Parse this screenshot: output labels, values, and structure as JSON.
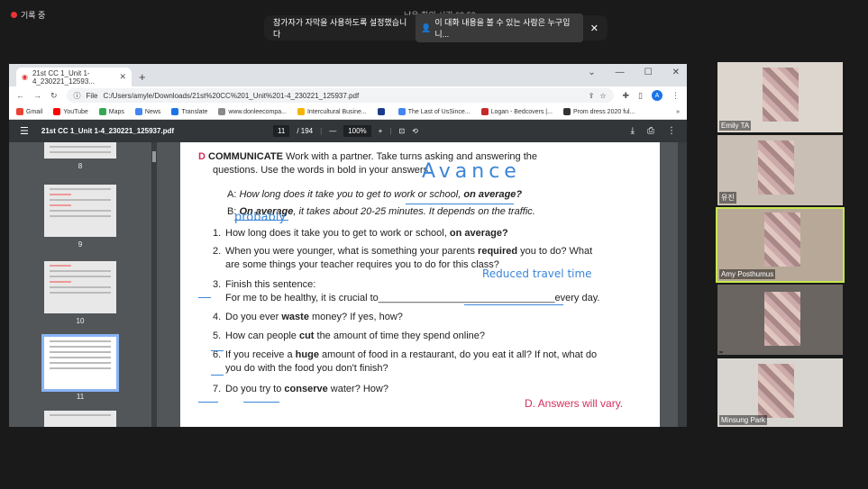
{
  "zoom": {
    "recording_label": "기록 중",
    "timer": "남은 회의 시간 09:53",
    "banner_text": "참가자가 자막을 사용하도록 설정했습니다",
    "banner_link": "이 대화 내용을 볼 수 있는 사람은 누구입니...",
    "close_glyph": "✕"
  },
  "browser": {
    "tab_title": "21st CC 1_Unit 1-4_230221_12593...",
    "address": "C:/Users/amyle/Downloads/21st%20CC%201_Unit%201-4_230221_125937.pdf",
    "file_label": "File",
    "bookmarks": [
      {
        "label": "Gmail",
        "color": "#ea4335"
      },
      {
        "label": "YouTube",
        "color": "#ff0000"
      },
      {
        "label": "Maps",
        "color": "#34a853"
      },
      {
        "label": "News",
        "color": "#4285f4"
      },
      {
        "label": "Translate",
        "color": "#1a73e8"
      },
      {
        "label": "www.donleecompa...",
        "color": "#888888"
      },
      {
        "label": "Intercultural Busine...",
        "color": "#f4b400"
      },
      {
        "label": "",
        "color": "#1a3a8a"
      },
      {
        "label": "The Last of UsSince...",
        "color": "#4285f4"
      },
      {
        "label": "Logan - Bedcovers |...",
        "color": "#c62828"
      },
      {
        "label": "Prom dress 2020 ful...",
        "color": "#333333"
      }
    ],
    "bookmarks_more": "»"
  },
  "pdf": {
    "title": "21st CC 1_Unit 1-4_230221_125937.pdf",
    "page_current": "11",
    "page_total": "/ 194",
    "zoom": "100%",
    "thumbs": [
      "8",
      "9",
      "10",
      "11"
    ],
    "section_letter": "D",
    "section_title": "COMMUNICATE",
    "section_intro": "Work with a partner. Take turns asking and answering the",
    "section_intro2": "questions. Use the words in bold in your answers.",
    "example_a_label": "A:",
    "example_a_text": "How long does it take you to get to work or school,",
    "example_a_bold": "on average?",
    "example_b_label": "B:",
    "example_b_bold": "On average",
    "example_b_text": ", it takes about 20-25 minutes. It depends on the traffic.",
    "questions": [
      {
        "n": "1.",
        "pre": "How long does it take you to get to work or school, ",
        "bold": "on average?",
        "post": "",
        "line2": ""
      },
      {
        "n": "2.",
        "pre": "When you were younger, what is something your parents ",
        "bold": "required",
        "post": " you to do? What",
        "line2": "are some things your teacher requires you to do for this class?"
      },
      {
        "n": "3.",
        "pre": "Finish this sentence:",
        "bold": "",
        "post": "",
        "line2": "For me to be healthy, it is crucial to________________________________every day."
      },
      {
        "n": "4.",
        "pre": "Do you ever ",
        "bold": "waste",
        "post": " money? If yes, how?",
        "line2": ""
      },
      {
        "n": "5.",
        "pre": "How can people ",
        "bold": "cut",
        "post": " the amount of time they spend online?",
        "line2": ""
      },
      {
        "n": "6.",
        "pre": "If you receive a ",
        "bold": "huge",
        "post": " amount of food in a restaurant, do you eat it all? If not, what do",
        "line2": "you do with the food you don't finish?"
      },
      {
        "n": "7.",
        "pre": "Do you try to ",
        "bold": "conserve",
        "post": " water? How?",
        "line2": ""
      }
    ],
    "answer_note": "D. Answers will vary.",
    "handwriting": {
      "avance": "Avance",
      "probably": "probably",
      "reduced": "Reduced travel time"
    }
  },
  "participants": [
    {
      "name": "Emily TA"
    },
    {
      "name": "유진"
    },
    {
      "name": "Amy Posthumus"
    },
    {
      "name": ""
    },
    {
      "name": "Minsung Park"
    }
  ]
}
